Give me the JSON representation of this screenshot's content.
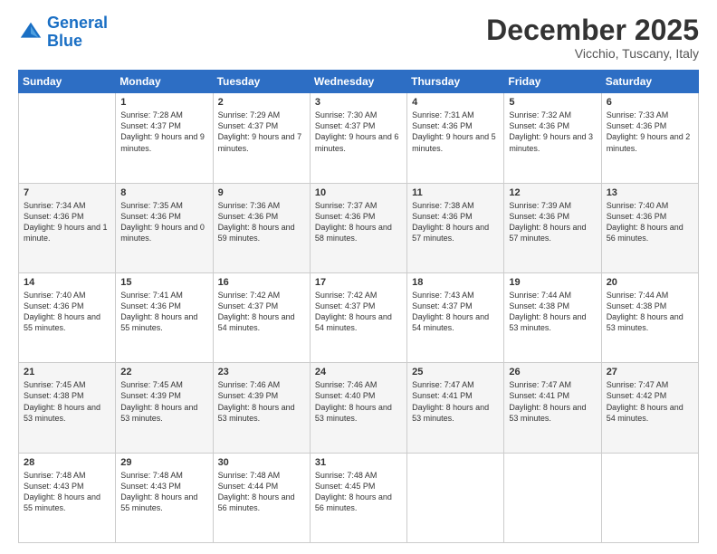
{
  "logo": {
    "line1": "General",
    "line2": "Blue"
  },
  "header": {
    "month": "December 2025",
    "location": "Vicchio, Tuscany, Italy"
  },
  "weekdays": [
    "Sunday",
    "Monday",
    "Tuesday",
    "Wednesday",
    "Thursday",
    "Friday",
    "Saturday"
  ],
  "weeks": [
    [
      {
        "day": "",
        "sunrise": "",
        "sunset": "",
        "daylight": ""
      },
      {
        "day": "1",
        "sunrise": "Sunrise: 7:28 AM",
        "sunset": "Sunset: 4:37 PM",
        "daylight": "Daylight: 9 hours and 9 minutes."
      },
      {
        "day": "2",
        "sunrise": "Sunrise: 7:29 AM",
        "sunset": "Sunset: 4:37 PM",
        "daylight": "Daylight: 9 hours and 7 minutes."
      },
      {
        "day": "3",
        "sunrise": "Sunrise: 7:30 AM",
        "sunset": "Sunset: 4:37 PM",
        "daylight": "Daylight: 9 hours and 6 minutes."
      },
      {
        "day": "4",
        "sunrise": "Sunrise: 7:31 AM",
        "sunset": "Sunset: 4:36 PM",
        "daylight": "Daylight: 9 hours and 5 minutes."
      },
      {
        "day": "5",
        "sunrise": "Sunrise: 7:32 AM",
        "sunset": "Sunset: 4:36 PM",
        "daylight": "Daylight: 9 hours and 3 minutes."
      },
      {
        "day": "6",
        "sunrise": "Sunrise: 7:33 AM",
        "sunset": "Sunset: 4:36 PM",
        "daylight": "Daylight: 9 hours and 2 minutes."
      }
    ],
    [
      {
        "day": "7",
        "sunrise": "Sunrise: 7:34 AM",
        "sunset": "Sunset: 4:36 PM",
        "daylight": "Daylight: 9 hours and 1 minute."
      },
      {
        "day": "8",
        "sunrise": "Sunrise: 7:35 AM",
        "sunset": "Sunset: 4:36 PM",
        "daylight": "Daylight: 9 hours and 0 minutes."
      },
      {
        "day": "9",
        "sunrise": "Sunrise: 7:36 AM",
        "sunset": "Sunset: 4:36 PM",
        "daylight": "Daylight: 8 hours and 59 minutes."
      },
      {
        "day": "10",
        "sunrise": "Sunrise: 7:37 AM",
        "sunset": "Sunset: 4:36 PM",
        "daylight": "Daylight: 8 hours and 58 minutes."
      },
      {
        "day": "11",
        "sunrise": "Sunrise: 7:38 AM",
        "sunset": "Sunset: 4:36 PM",
        "daylight": "Daylight: 8 hours and 57 minutes."
      },
      {
        "day": "12",
        "sunrise": "Sunrise: 7:39 AM",
        "sunset": "Sunset: 4:36 PM",
        "daylight": "Daylight: 8 hours and 57 minutes."
      },
      {
        "day": "13",
        "sunrise": "Sunrise: 7:40 AM",
        "sunset": "Sunset: 4:36 PM",
        "daylight": "Daylight: 8 hours and 56 minutes."
      }
    ],
    [
      {
        "day": "14",
        "sunrise": "Sunrise: 7:40 AM",
        "sunset": "Sunset: 4:36 PM",
        "daylight": "Daylight: 8 hours and 55 minutes."
      },
      {
        "day": "15",
        "sunrise": "Sunrise: 7:41 AM",
        "sunset": "Sunset: 4:36 PM",
        "daylight": "Daylight: 8 hours and 55 minutes."
      },
      {
        "day": "16",
        "sunrise": "Sunrise: 7:42 AM",
        "sunset": "Sunset: 4:37 PM",
        "daylight": "Daylight: 8 hours and 54 minutes."
      },
      {
        "day": "17",
        "sunrise": "Sunrise: 7:42 AM",
        "sunset": "Sunset: 4:37 PM",
        "daylight": "Daylight: 8 hours and 54 minutes."
      },
      {
        "day": "18",
        "sunrise": "Sunrise: 7:43 AM",
        "sunset": "Sunset: 4:37 PM",
        "daylight": "Daylight: 8 hours and 54 minutes."
      },
      {
        "day": "19",
        "sunrise": "Sunrise: 7:44 AM",
        "sunset": "Sunset: 4:38 PM",
        "daylight": "Daylight: 8 hours and 53 minutes."
      },
      {
        "day": "20",
        "sunrise": "Sunrise: 7:44 AM",
        "sunset": "Sunset: 4:38 PM",
        "daylight": "Daylight: 8 hours and 53 minutes."
      }
    ],
    [
      {
        "day": "21",
        "sunrise": "Sunrise: 7:45 AM",
        "sunset": "Sunset: 4:38 PM",
        "daylight": "Daylight: 8 hours and 53 minutes."
      },
      {
        "day": "22",
        "sunrise": "Sunrise: 7:45 AM",
        "sunset": "Sunset: 4:39 PM",
        "daylight": "Daylight: 8 hours and 53 minutes."
      },
      {
        "day": "23",
        "sunrise": "Sunrise: 7:46 AM",
        "sunset": "Sunset: 4:39 PM",
        "daylight": "Daylight: 8 hours and 53 minutes."
      },
      {
        "day": "24",
        "sunrise": "Sunrise: 7:46 AM",
        "sunset": "Sunset: 4:40 PM",
        "daylight": "Daylight: 8 hours and 53 minutes."
      },
      {
        "day": "25",
        "sunrise": "Sunrise: 7:47 AM",
        "sunset": "Sunset: 4:41 PM",
        "daylight": "Daylight: 8 hours and 53 minutes."
      },
      {
        "day": "26",
        "sunrise": "Sunrise: 7:47 AM",
        "sunset": "Sunset: 4:41 PM",
        "daylight": "Daylight: 8 hours and 53 minutes."
      },
      {
        "day": "27",
        "sunrise": "Sunrise: 7:47 AM",
        "sunset": "Sunset: 4:42 PM",
        "daylight": "Daylight: 8 hours and 54 minutes."
      }
    ],
    [
      {
        "day": "28",
        "sunrise": "Sunrise: 7:48 AM",
        "sunset": "Sunset: 4:43 PM",
        "daylight": "Daylight: 8 hours and 55 minutes."
      },
      {
        "day": "29",
        "sunrise": "Sunrise: 7:48 AM",
        "sunset": "Sunset: 4:43 PM",
        "daylight": "Daylight: 8 hours and 55 minutes."
      },
      {
        "day": "30",
        "sunrise": "Sunrise: 7:48 AM",
        "sunset": "Sunset: 4:44 PM",
        "daylight": "Daylight: 8 hours and 56 minutes."
      },
      {
        "day": "31",
        "sunrise": "Sunrise: 7:48 AM",
        "sunset": "Sunset: 4:45 PM",
        "daylight": "Daylight: 8 hours and 56 minutes."
      },
      {
        "day": "",
        "sunrise": "",
        "sunset": "",
        "daylight": ""
      },
      {
        "day": "",
        "sunrise": "",
        "sunset": "",
        "daylight": ""
      },
      {
        "day": "",
        "sunrise": "",
        "sunset": "",
        "daylight": ""
      }
    ]
  ]
}
